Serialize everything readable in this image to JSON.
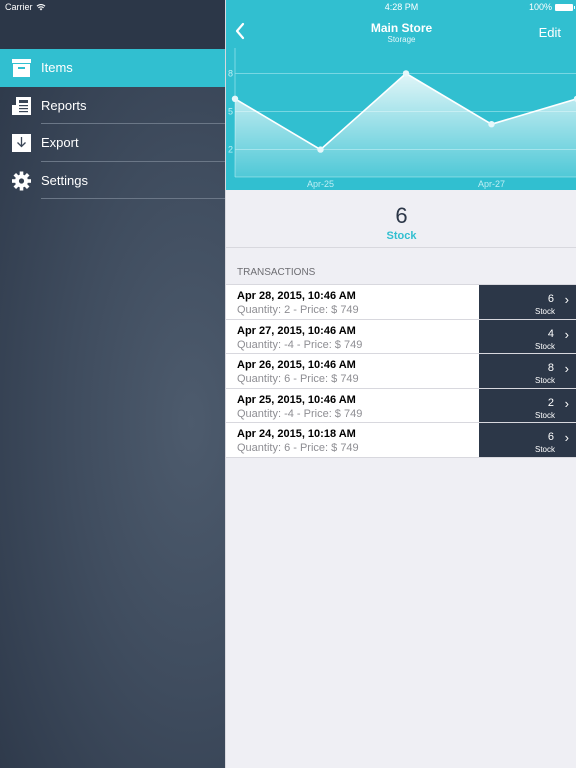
{
  "status_bar": {
    "carrier": "Carrier",
    "time": "4:28 PM",
    "battery": "100%",
    "wifi_icon": "wifi-icon",
    "battery_icon": "battery-icon"
  },
  "sidebar": {
    "items": [
      {
        "label": "Items",
        "icon": "archive-box-icon",
        "active": true
      },
      {
        "label": "Reports",
        "icon": "newspaper-icon",
        "active": false
      },
      {
        "label": "Export",
        "icon": "download-icon",
        "active": false
      },
      {
        "label": "Settings",
        "icon": "gear-icon",
        "active": false
      }
    ]
  },
  "nav": {
    "back_icon": "chevron-left-icon",
    "title": "Main Store",
    "subtitle": "Storage",
    "edit_label": "Edit"
  },
  "colors": {
    "accent": "#31bfd0",
    "dark": "#2c3748",
    "background": "#efeff4"
  },
  "chart_data": {
    "type": "area",
    "title": "",
    "xlabel": "",
    "ylabel": "",
    "x": [
      "Apr-24",
      "Apr-25",
      "Apr-26",
      "Apr-27",
      "Apr-28"
    ],
    "x_tick_labels": [
      "Apr-25",
      "Apr-27"
    ],
    "series": [
      {
        "name": "Stock",
        "values": [
          6,
          2,
          8,
          4,
          6
        ]
      }
    ],
    "y_ticks": [
      2,
      5,
      8
    ],
    "ylim": [
      0,
      10
    ],
    "grid": true,
    "legend": "none"
  },
  "summary": {
    "value": "6",
    "label": "Stock"
  },
  "transactions": {
    "header": "TRANSACTIONS",
    "rows": [
      {
        "date": "Apr 28, 2015, 10:46 AM",
        "detail": "Quantity: 2 - Price: $ 749",
        "stock": "6",
        "unit": "Stock"
      },
      {
        "date": "Apr 27, 2015, 10:46 AM",
        "detail": "Quantity: -4 - Price: $ 749",
        "stock": "4",
        "unit": "Stock"
      },
      {
        "date": "Apr 26, 2015, 10:46 AM",
        "detail": "Quantity: 6 - Price: $ 749",
        "stock": "8",
        "unit": "Stock"
      },
      {
        "date": "Apr 25, 2015, 10:46 AM",
        "detail": "Quantity: -4 - Price: $ 749",
        "stock": "2",
        "unit": "Stock"
      },
      {
        "date": "Apr 24, 2015, 10:18 AM",
        "detail": "Quantity: 6 - Price: $ 749",
        "stock": "6",
        "unit": "Stock"
      }
    ]
  }
}
